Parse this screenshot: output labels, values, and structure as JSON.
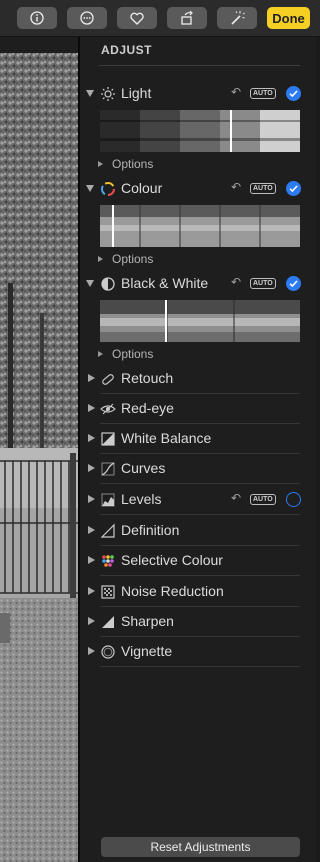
{
  "toolbar": {
    "buttons": [
      "info-icon",
      "more-icon",
      "heart-icon",
      "rotate-icon",
      "magic-wand-icon"
    ],
    "done_label": "Done"
  },
  "panel": {
    "title": "ADJUST",
    "expanded": [
      {
        "label": "Light",
        "icon": "sun-icon",
        "has_auto": true,
        "auto_label": "AUTO",
        "checked": true,
        "options_label": "Options"
      },
      {
        "label": "Colour",
        "icon": "colour-wheel-icon",
        "has_auto": true,
        "auto_label": "AUTO",
        "checked": true,
        "options_label": "Options"
      },
      {
        "label": "Black & White",
        "icon": "half-circle-icon",
        "has_auto": true,
        "auto_label": "AUTO",
        "checked": true,
        "options_label": "Options"
      }
    ],
    "collapsed": [
      {
        "label": "Retouch",
        "icon": "bandage-icon"
      },
      {
        "label": "Red-eye",
        "icon": "eye-icon"
      },
      {
        "label": "White Balance",
        "icon": "white-balance-icon"
      },
      {
        "label": "Curves",
        "icon": "curves-icon"
      },
      {
        "label": "Levels",
        "icon": "levels-icon",
        "has_auto": true,
        "auto_label": "AUTO",
        "checked": false
      },
      {
        "label": "Definition",
        "icon": "definition-icon"
      },
      {
        "label": "Selective Colour",
        "icon": "selective-colour-icon"
      },
      {
        "label": "Noise Reduction",
        "icon": "noise-reduction-icon"
      },
      {
        "label": "Sharpen",
        "icon": "sharpen-icon"
      },
      {
        "label": "Vignette",
        "icon": "vignette-icon"
      }
    ],
    "reset_label": "Reset Adjustments"
  },
  "colors": {
    "accent": "#2c7bf3",
    "done": "#f5cf23",
    "panel_bg": "#1e1e1e"
  }
}
